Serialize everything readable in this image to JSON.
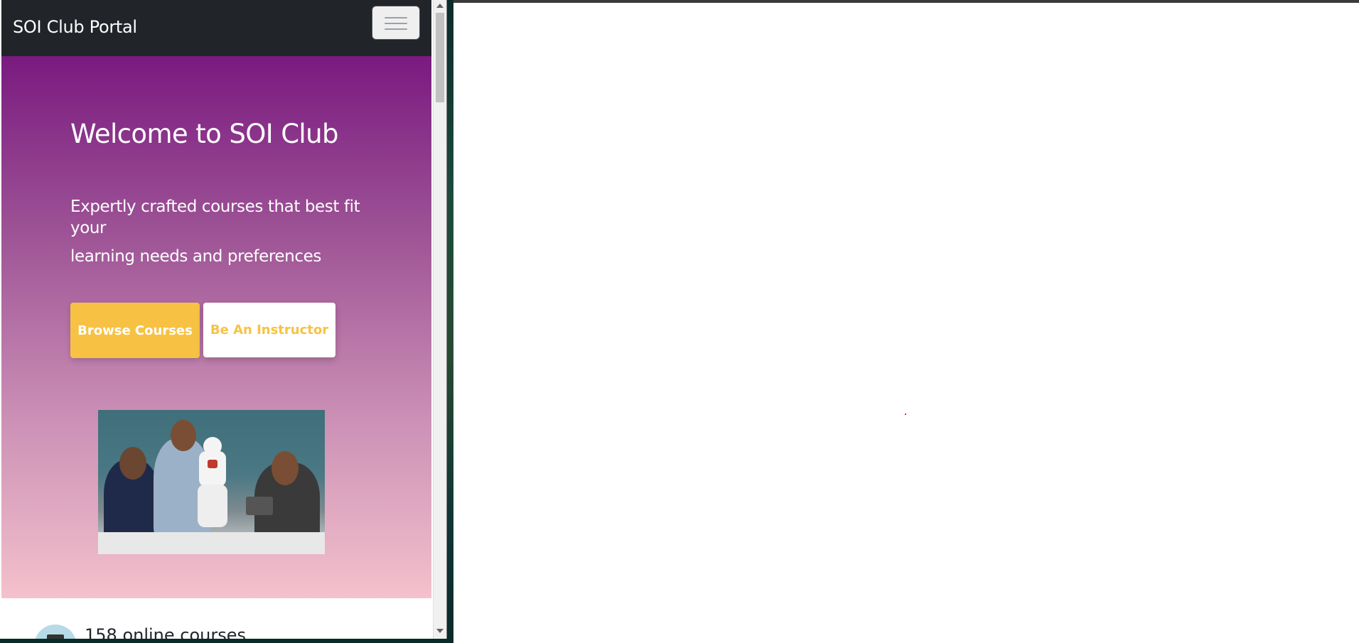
{
  "navbar": {
    "brand": "SOI Club Portal",
    "toggler_icon": "hamburger-menu-icon"
  },
  "hero": {
    "title": "Welcome to SOI Club",
    "subtitle_line1": "Expertly crafted courses that best fit",
    "subtitle_line2": "your",
    "subtitle_line3": "learning needs and preferences",
    "browse_button": "Browse Courses",
    "instructor_button": "Be An Instructor",
    "image_alt": "Students with humanoid robot",
    "gradient_top": "#7a1a80",
    "gradient_bottom": "#f4c1cc",
    "accent": "#f7c244"
  },
  "features": {
    "item1_text": "158 online courses",
    "item1_icon": "laptop-icon"
  },
  "right_window": {
    "background": "#ffffff"
  }
}
